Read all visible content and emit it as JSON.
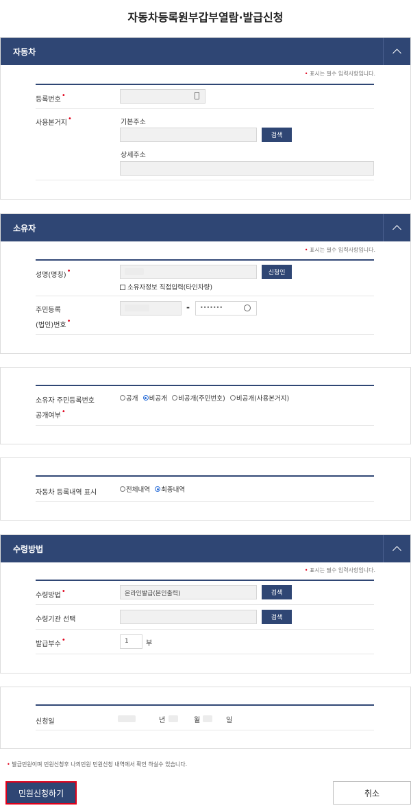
{
  "page": {
    "title": "자동차등록원부갑부열람·발급신청"
  },
  "required_note": "표시는 필수 입력사항입니다.",
  "vehicle": {
    "title": "자동차",
    "reg_number_label": "등록번호",
    "location_label": "사용본거지",
    "basic_address_label": "기본주소",
    "detail_address_label": "상세주소",
    "search_label": "검색"
  },
  "owner": {
    "title": "소유자",
    "name_label": "성명(명칭)",
    "applicant_button": "신청인",
    "direct_input_label": "소유자정보 직접입력(타인차량)",
    "id_label_line1": "주민등록",
    "id_label_line2": "(법인)번호",
    "id_dash": "-",
    "id_back_value": "•••••••"
  },
  "disclosure": {
    "label_line1": "소유자 주민등록번호",
    "label_line2": "공개여부",
    "options": [
      "공개",
      "비공개",
      "비공개(주민번호)",
      "비공개(사용본거지)"
    ],
    "selected": "비공개"
  },
  "history": {
    "label": "자동차 등록내역 표시",
    "options": [
      "전체내역",
      "최종내역"
    ],
    "selected": "최종내역"
  },
  "receipt": {
    "title": "수령방법",
    "method_label": "수령방법",
    "method_value": "온라인발급(본인출력)",
    "agency_label": "수령기관 선택",
    "copies_label": "발급부수",
    "copies_value": "1",
    "copies_unit": "부",
    "search_label": "검색"
  },
  "apply_date": {
    "label": "신청일",
    "year_unit": "년",
    "month_unit": "월",
    "day_unit": "일"
  },
  "footer": {
    "note": "발급민원이며 민원신청후 나의민원 민원신청 내역에서 확인 하실수 있습니다.",
    "submit_label": "민원신청하기",
    "cancel_label": "취소"
  },
  "colors": {
    "header_navy": "#2f4674",
    "required_red": "#e0001a",
    "radio_blue": "#2a6ed8"
  }
}
